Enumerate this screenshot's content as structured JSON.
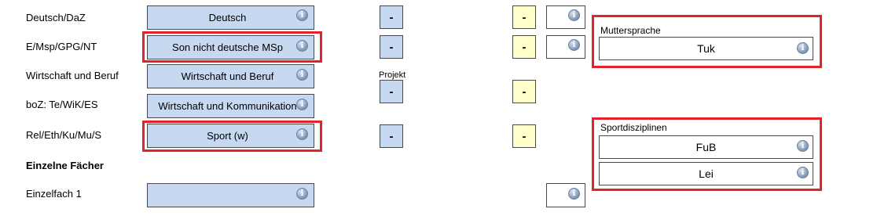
{
  "labels": {
    "row1": "Deutsch/DaZ",
    "row2": "E/Msp/GPG/NT",
    "row3": "Wirtschaft und Beruf",
    "row4": "boZ: Te/WiK/ES",
    "row5": "Rel/Eth/Ku/Mu/S",
    "section": "Einzelne Fächer",
    "row6": "Einzelfach 1"
  },
  "fields": {
    "row1": "Deutsch",
    "row2": "Son nicht deutsche MSp",
    "row3": "Wirtschaft und Beruf",
    "row4": "Wirtschaft und Kommunikation",
    "row5": "Sport (w)",
    "row6": ""
  },
  "dash": "-",
  "projekt_label": "Projekt",
  "muttersprache": {
    "title": "Muttersprache",
    "value": "Tuk"
  },
  "sportdisziplinen": {
    "title": "Sportdisziplinen",
    "values": [
      "FuB",
      "Lei"
    ]
  },
  "icons": {
    "info": "info-icon"
  },
  "colors": {
    "field_blue": "#c6d9f1",
    "field_yellow": "#ffffcc",
    "highlight_red": "#e3222b"
  }
}
